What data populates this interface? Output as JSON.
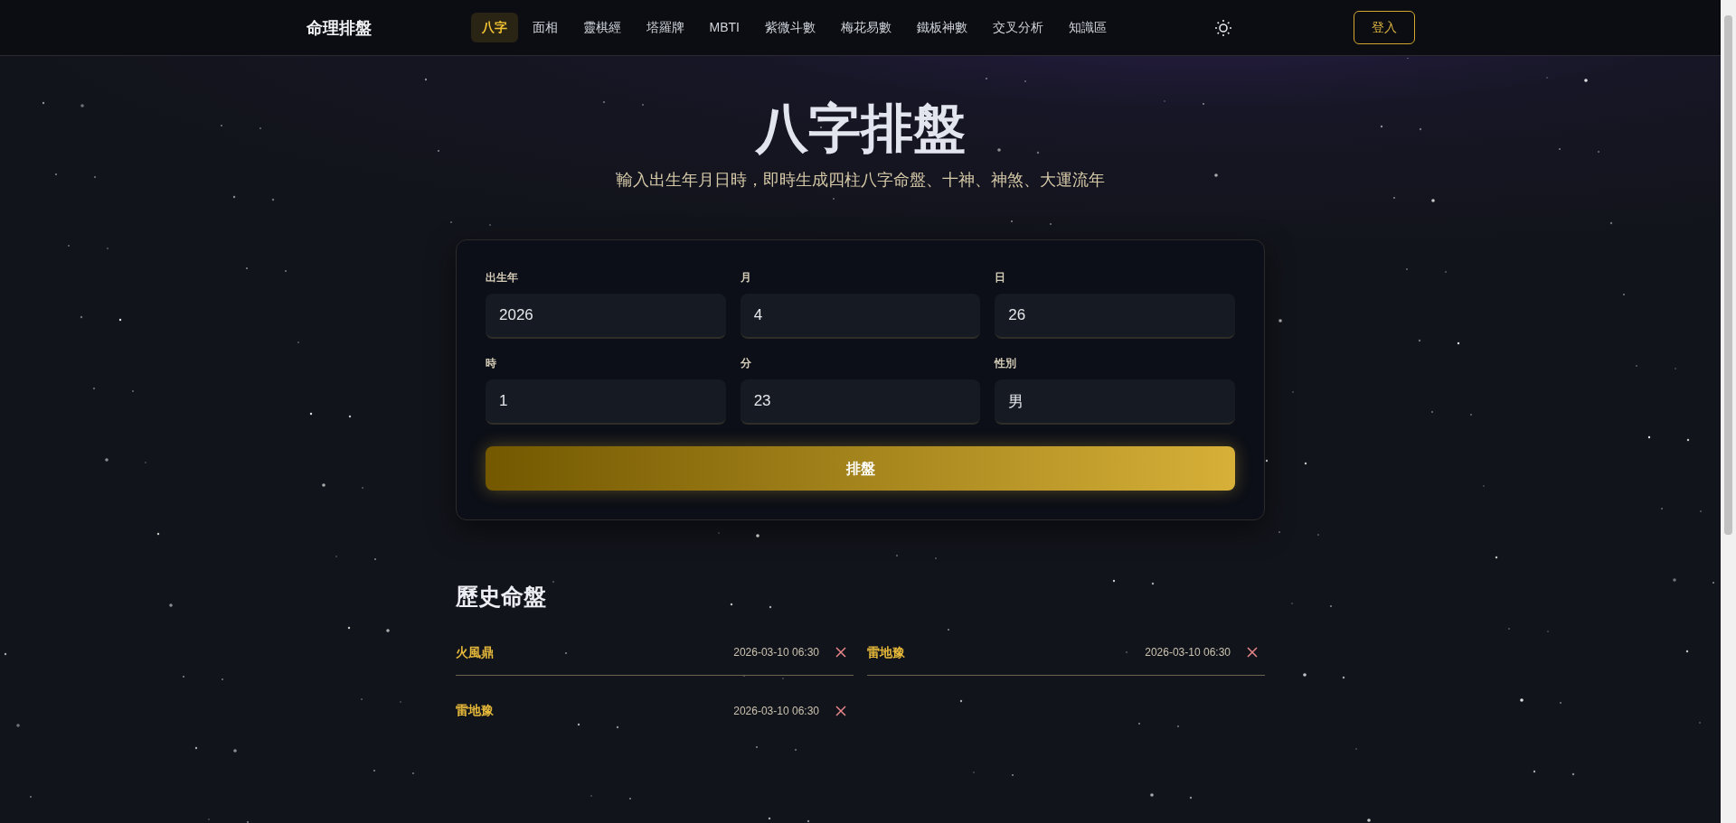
{
  "nav": {
    "logo": "命理排盤",
    "items": [
      {
        "label": "八字",
        "selected": true
      },
      {
        "label": "面相",
        "selected": false
      },
      {
        "label": "靈棋經",
        "selected": false
      },
      {
        "label": "塔羅牌",
        "selected": false
      },
      {
        "label": "MBTI",
        "selected": false
      },
      {
        "label": "紫微斗數",
        "selected": false
      },
      {
        "label": "梅花易數",
        "selected": false
      },
      {
        "label": "鐵板神數",
        "selected": false
      },
      {
        "label": "交叉分析",
        "selected": false
      },
      {
        "label": "知識區",
        "selected": false
      }
    ],
    "login": "登入"
  },
  "header": {
    "title": "八字排盤",
    "subtitle": "輸入出生年月日時，即時生成四柱八字命盤、十神、神煞、大運流年"
  },
  "form": {
    "fields": [
      {
        "label": "出生年",
        "value": "2026"
      },
      {
        "label": "月",
        "value": "4"
      },
      {
        "label": "日",
        "value": "26"
      },
      {
        "label": "時",
        "value": "1"
      },
      {
        "label": "分",
        "value": "23"
      },
      {
        "label": "性別",
        "value": "男"
      }
    ],
    "submit": "排盤"
  },
  "history": {
    "title": "歷史命盤",
    "items": [
      {
        "name": "火風鼎",
        "time": "2026-03-10 06:30"
      },
      {
        "name": "雷地豫",
        "time": "2026-03-10 06:30"
      },
      {
        "name": "雷地豫",
        "time": "2026-03-10 06:30"
      }
    ]
  }
}
